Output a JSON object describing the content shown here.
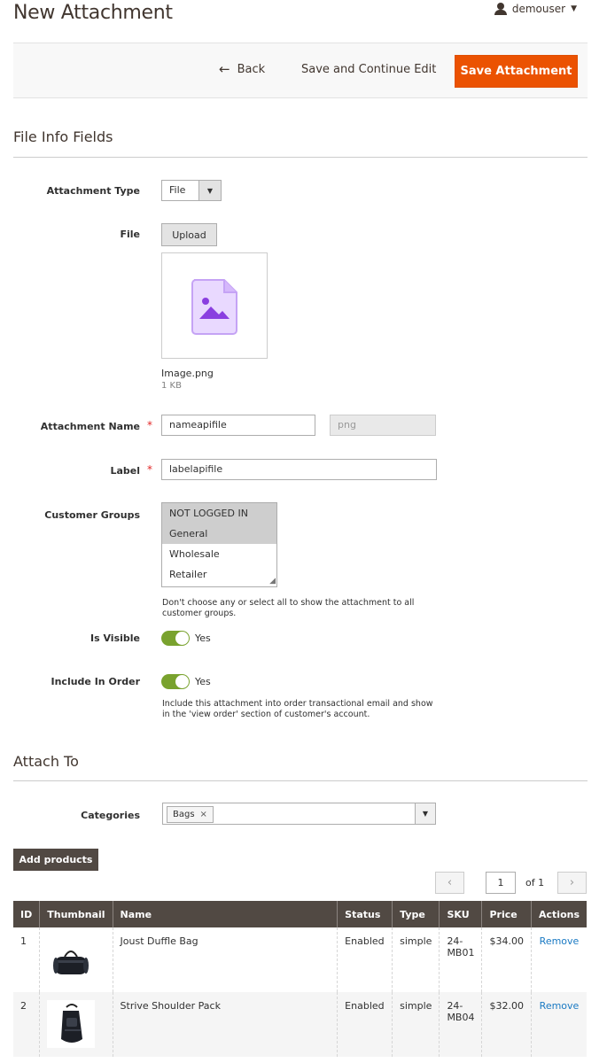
{
  "header": {
    "page_title": "New Attachment",
    "user_name": "demouser"
  },
  "actions": {
    "back_label": "Back",
    "save_continue_label": "Save and Continue Edit",
    "save_label": "Save Attachment"
  },
  "file_info": {
    "section_title": "File Info Fields",
    "attachment_type_label": "Attachment Type",
    "attachment_type_value": "File",
    "file_label": "File",
    "upload_label": "Upload",
    "file_name": "Image.png",
    "file_size": "1 KB",
    "attachment_name_label": "Attachment Name",
    "attachment_name_value": "nameapifile",
    "extension_value": "png",
    "label_label": "Label",
    "label_value": "labelapifile",
    "customer_groups_label": "Customer Groups",
    "customer_groups": [
      {
        "label": "NOT LOGGED IN",
        "selected": true
      },
      {
        "label": "General",
        "selected": true
      },
      {
        "label": "Wholesale",
        "selected": false
      },
      {
        "label": "Retailer",
        "selected": false
      }
    ],
    "customer_groups_note": "Don't choose any or select all to show the attachment to all customer groups.",
    "is_visible_label": "Is Visible",
    "is_visible_value": "Yes",
    "include_in_order_label": "Include In Order",
    "include_in_order_value": "Yes",
    "include_in_order_note": "Include this attachment into order transactional email and show in the 'view order' section of customer's account."
  },
  "attach_to": {
    "section_title": "Attach To",
    "categories_label": "Categories",
    "category_chip": "Bags",
    "add_products_label": "Add products",
    "pager": {
      "current_page": "1",
      "of_label": "of 1"
    },
    "columns": [
      "ID",
      "Thumbnail",
      "Name",
      "Status",
      "Type",
      "SKU",
      "Price",
      "Actions"
    ],
    "rows": [
      {
        "id": "1",
        "name": "Joust Duffle Bag",
        "status": "Enabled",
        "type": "simple",
        "sku": "24-MB01",
        "price": "$34.00",
        "action": "Remove"
      },
      {
        "id": "2",
        "name": "Strive Shoulder Pack",
        "status": "Enabled",
        "type": "simple",
        "sku": "24-MB04",
        "price": "$32.00",
        "action": "Remove"
      }
    ]
  },
  "colors": {
    "accent": "#eb5202",
    "dark": "#514943",
    "toggle_on": "#79a22e",
    "link": "#1979c3",
    "required": "#e22626"
  }
}
